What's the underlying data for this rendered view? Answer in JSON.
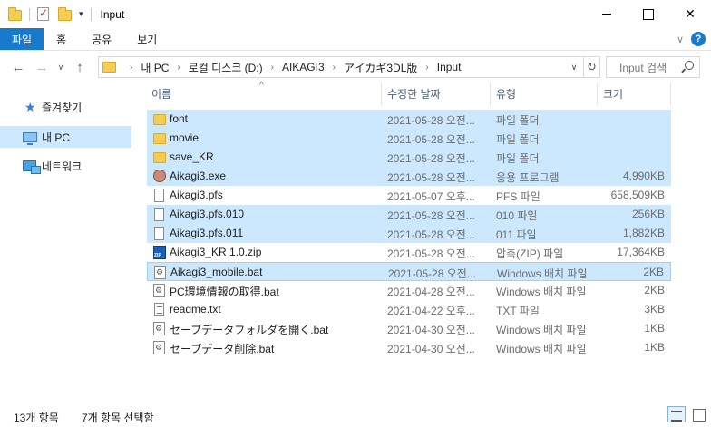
{
  "window": {
    "title": "Input",
    "close_glyph": "✕"
  },
  "ribbon": {
    "tabs": [
      "파일",
      "홈",
      "공유",
      "보기"
    ],
    "collapse_glyph": "∨",
    "help_glyph": "?"
  },
  "nav": {
    "back_glyph": "←",
    "forward_glyph": "→",
    "recent_glyph": "∨",
    "up_glyph": "↑",
    "breadcrumb": [
      "내 PC",
      "로컬 디스크 (D:)",
      "AIKAGI3",
      "アイカギ3DL版",
      "Input"
    ],
    "crumb_sep": "›",
    "dropdown_glyph": "∨",
    "refresh_glyph": "↻",
    "search_placeholder": "Input 검색"
  },
  "sidebar": {
    "items": [
      {
        "label": "즐겨찾기",
        "icon": "star-icon",
        "selected": false
      },
      {
        "label": "내 PC",
        "icon": "pc-icon",
        "selected": true
      },
      {
        "label": "네트워크",
        "icon": "network-icon",
        "selected": false
      }
    ]
  },
  "columns": {
    "name": "이름",
    "date": "수정한 날짜",
    "type": "유형",
    "size": "크기",
    "sort_glyph": "^"
  },
  "files": [
    {
      "name": "font",
      "date": "2021-05-28 오전...",
      "type": "파일 폴더",
      "size": "",
      "icon": "folder",
      "selected": true
    },
    {
      "name": "movie",
      "date": "2021-05-28 오전...",
      "type": "파일 폴더",
      "size": "",
      "icon": "folder",
      "selected": true
    },
    {
      "name": "save_KR",
      "date": "2021-05-28 오전...",
      "type": "파일 폴더",
      "size": "",
      "icon": "folder",
      "selected": true
    },
    {
      "name": "Aikagi3.exe",
      "date": "2021-05-28 오전...",
      "type": "응용 프로그램",
      "size": "4,990KB",
      "icon": "exe",
      "selected": true
    },
    {
      "name": "Aikagi3.pfs",
      "date": "2021-05-07 오후...",
      "type": "PFS 파일",
      "size": "658,509KB",
      "icon": "doc",
      "selected": false
    },
    {
      "name": "Aikagi3.pfs.010",
      "date": "2021-05-28 오전...",
      "type": "010 파일",
      "size": "256KB",
      "icon": "doc",
      "selected": true
    },
    {
      "name": "Aikagi3.pfs.011",
      "date": "2021-05-28 오전...",
      "type": "011 파일",
      "size": "1,882KB",
      "icon": "doc",
      "selected": true
    },
    {
      "name": "Aikagi3_KR 1.0.zip",
      "date": "2021-05-28 오전...",
      "type": "압축(ZIP) 파일",
      "size": "17,364KB",
      "icon": "zip",
      "selected": false
    },
    {
      "name": "Aikagi3_mobile.bat",
      "date": "2021-05-28 오전...",
      "type": "Windows 배치 파일",
      "size": "2KB",
      "icon": "bat",
      "selected": true
    },
    {
      "name": "PC環境情報の取得.bat",
      "date": "2021-04-28 오전...",
      "type": "Windows 배치 파일",
      "size": "2KB",
      "icon": "bat",
      "selected": false
    },
    {
      "name": "readme.txt",
      "date": "2021-04-22 오후...",
      "type": "TXT 파일",
      "size": "3KB",
      "icon": "txt",
      "selected": false
    },
    {
      "name": "セーブデータフォルダを開く.bat",
      "date": "2021-04-30 오전...",
      "type": "Windows 배치 파일",
      "size": "1KB",
      "icon": "bat",
      "selected": false
    },
    {
      "name": "セーブデータ削除.bat",
      "date": "2021-04-30 오전...",
      "type": "Windows 배치 파일",
      "size": "1KB",
      "icon": "bat",
      "selected": false
    }
  ],
  "status": {
    "item_count": "13개 항목",
    "selected_count": "7개 항목 선택함"
  },
  "colors": {
    "accent": "#1979ca",
    "selection": "#cce8ff",
    "folder": "#f6cd52"
  }
}
